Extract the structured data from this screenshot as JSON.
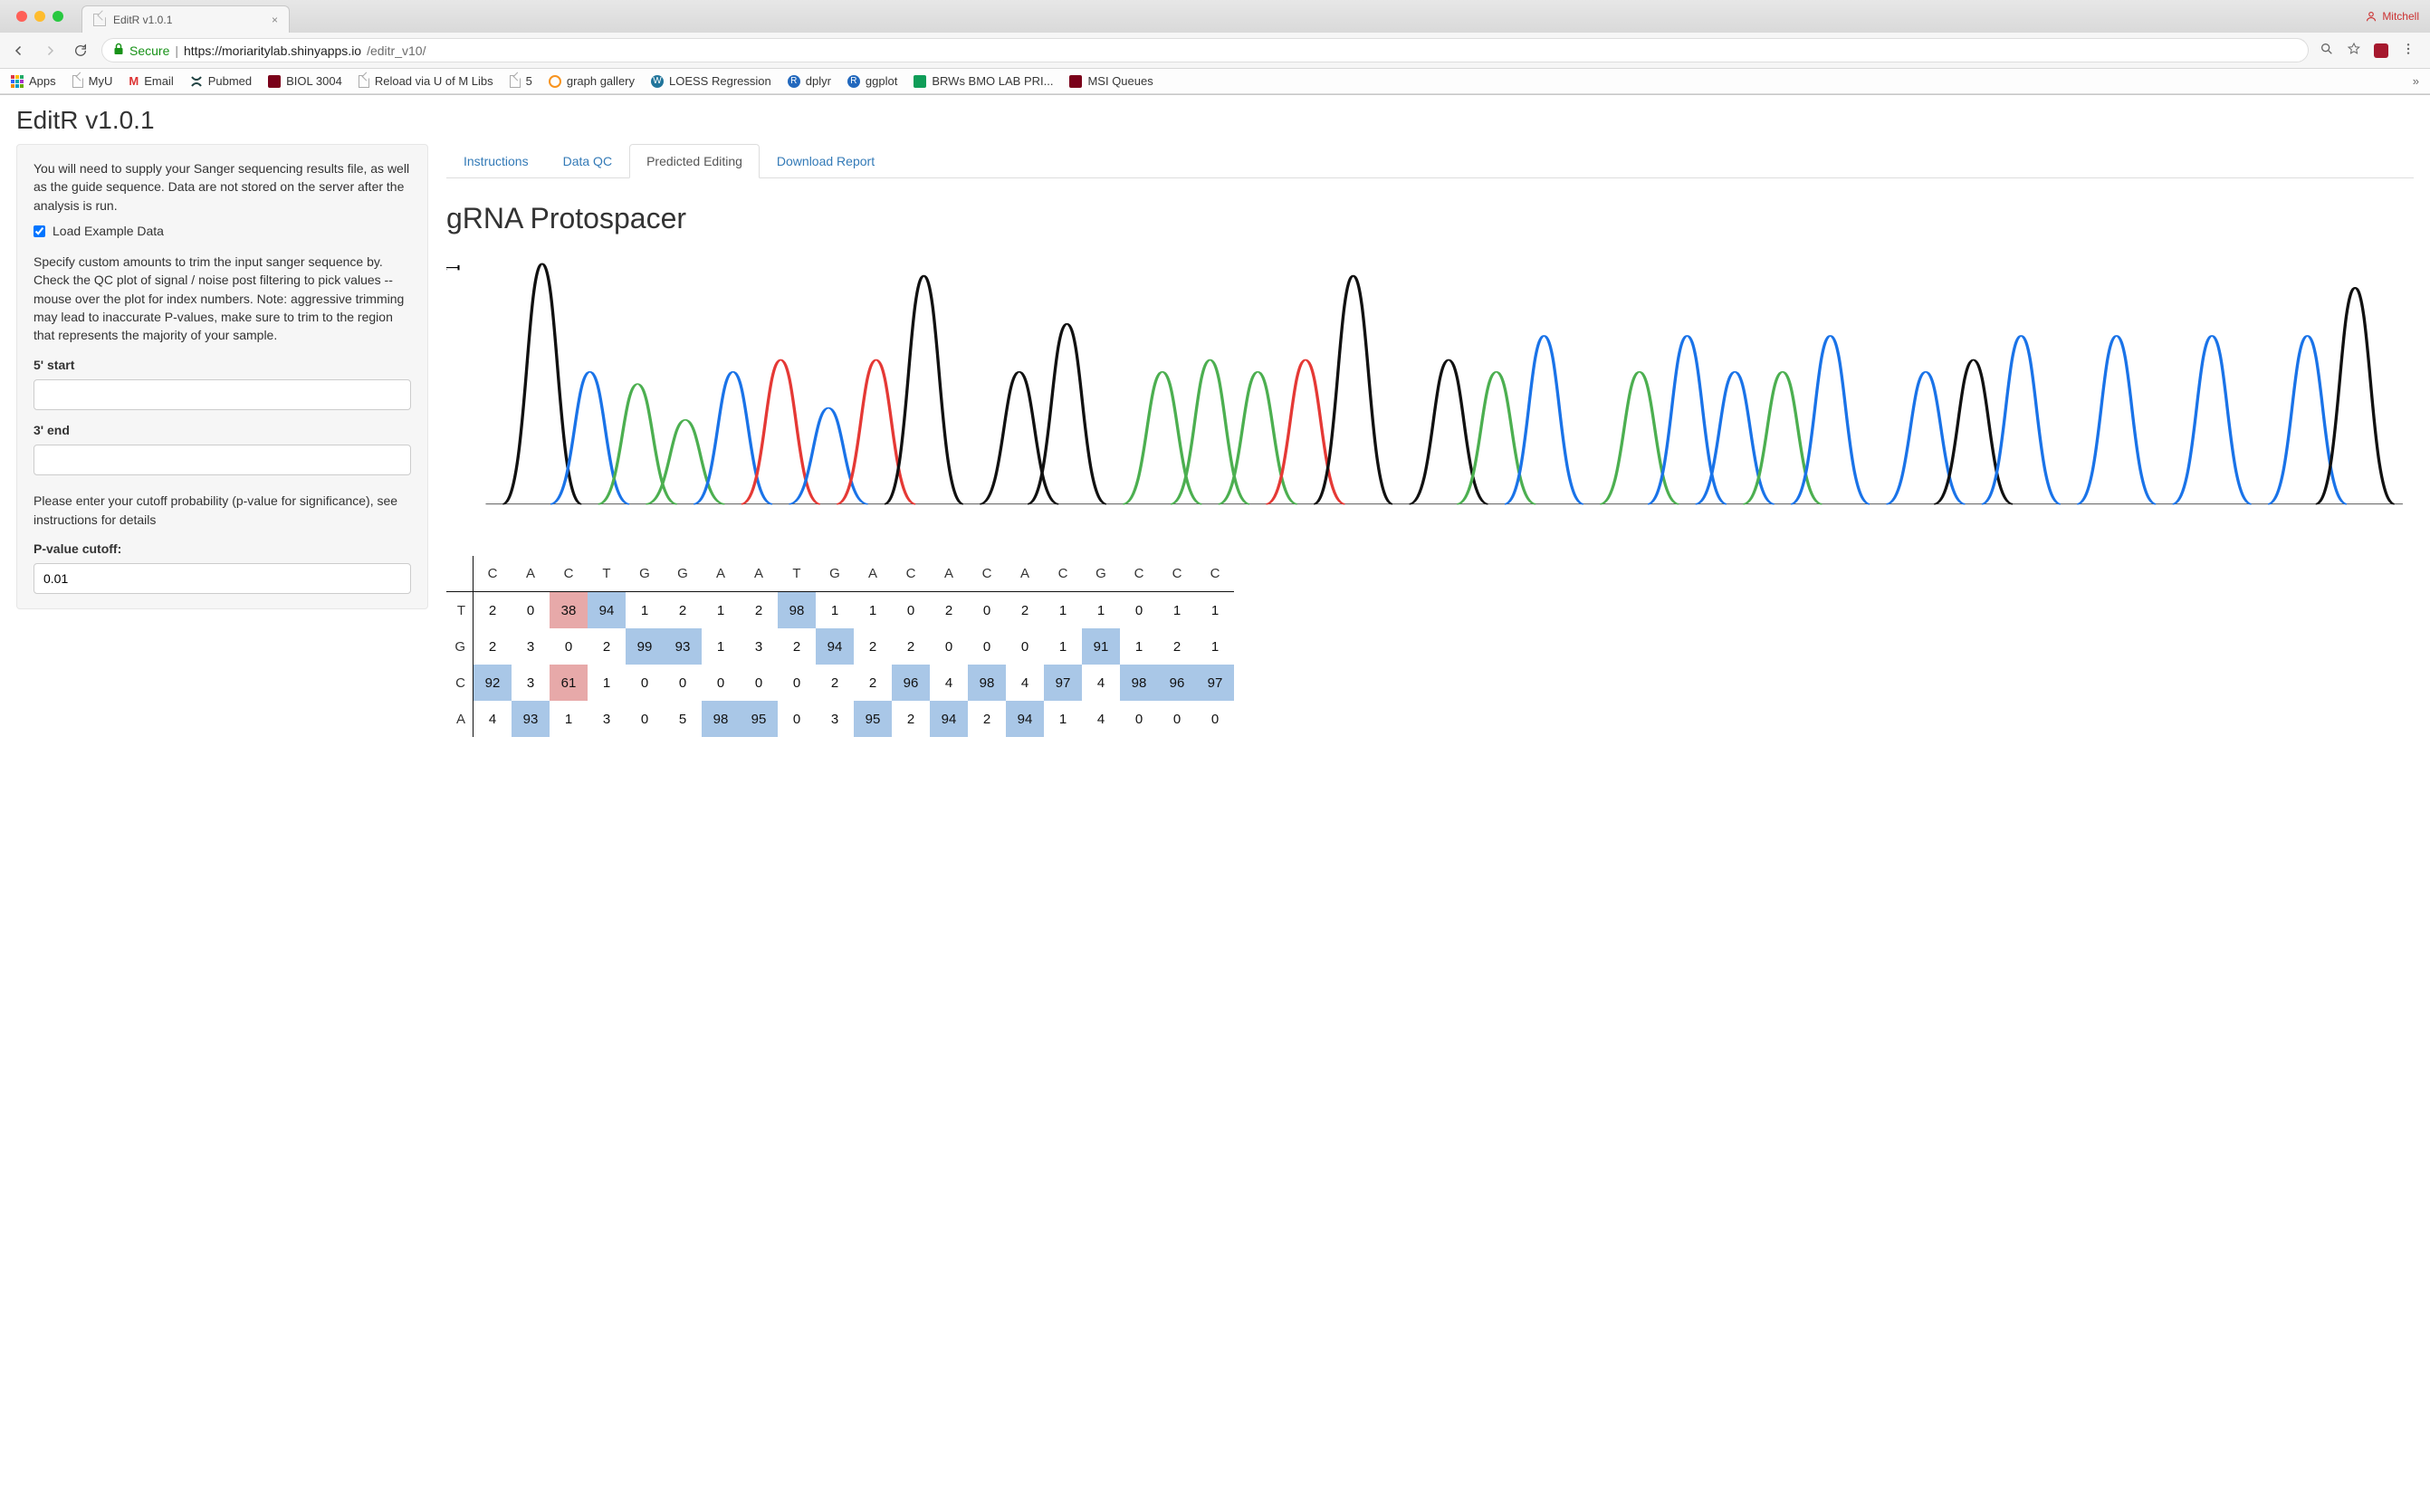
{
  "browser": {
    "tab_title": "EditR v1.0.1",
    "profile_name": "Mitchell",
    "url_secure_label": "Secure",
    "url_host": "https://moriaritylab.shinyapps.io",
    "url_path": "/editr_v10/"
  },
  "bookmarks": [
    {
      "label": "Apps",
      "icon": "apps"
    },
    {
      "label": "MyU",
      "icon": "file"
    },
    {
      "label": "Email",
      "icon": "gmail"
    },
    {
      "label": "Pubmed",
      "icon": "ncbi"
    },
    {
      "label": "BIOL 3004",
      "icon": "umn"
    },
    {
      "label": "Reload via U of M Libs",
      "icon": "file"
    },
    {
      "label": "5",
      "icon": "file"
    },
    {
      "label": "graph gallery",
      "icon": "orange-circle"
    },
    {
      "label": "LOESS Regression",
      "icon": "wp"
    },
    {
      "label": "dplyr",
      "icon": "r"
    },
    {
      "label": "ggplot",
      "icon": "r"
    },
    {
      "label": "BRWs BMO LAB PRI...",
      "icon": "sheet"
    },
    {
      "label": "MSI Queues",
      "icon": "umn"
    }
  ],
  "app": {
    "title": "EditR v1.0.1",
    "sidebar": {
      "intro": "You will need to supply your Sanger sequencing results file, as well as the guide sequence. Data are not stored on the server after the analysis is run.",
      "load_example_label": "Load Example Data",
      "load_example_checked": true,
      "trim_help": "Specify custom amounts to trim the input sanger sequence by. Check the QC plot of signal / noise post filtering to pick values -- mouse over the plot for index numbers. Note: aggressive trimming may lead to inaccurate P-values, make sure to trim to the region that represents the majority of your sample.",
      "label_5p": "5' start",
      "value_5p": "",
      "label_3p": "3' end",
      "value_3p": "",
      "pval_help": "Please enter your cutoff probability (p-value for significance), see instructions for details",
      "label_pval": "P-value cutoff:",
      "value_pval": "0.01"
    },
    "tabs": {
      "instructions": "Instructions",
      "data_qc": "Data QC",
      "predicted": "Predicted Editing",
      "download": "Download Report",
      "active": "predicted"
    },
    "section_title": "gRNA Protospacer"
  },
  "chart_data": {
    "type": "line",
    "title": "gRNA Protospacer",
    "xlabel": "",
    "ylabel": "1",
    "y_axis_ticks": [
      "1"
    ],
    "xlim": [
      0,
      20
    ],
    "ylim": [
      0,
      1
    ],
    "base_colors": {
      "A": "#4caf50",
      "C": "#1a73e8",
      "G": "#111111",
      "T": "#e53935"
    },
    "protospacer": [
      "C",
      "A",
      "C",
      "T",
      "G",
      "G",
      "A",
      "A",
      "T",
      "G",
      "A",
      "C",
      "A",
      "C",
      "A",
      "C",
      "G",
      "C",
      "C",
      "C"
    ],
    "peaks": [
      {
        "pos": 0.5,
        "base": "G",
        "height": 1.0
      },
      {
        "pos": 1.0,
        "base": "C",
        "height": 0.55
      },
      {
        "pos": 1.5,
        "base": "A",
        "height": 0.5
      },
      {
        "pos": 2.0,
        "base": "A",
        "height": 0.35
      },
      {
        "pos": 2.5,
        "base": "C",
        "height": 0.55
      },
      {
        "pos": 3.0,
        "base": "T",
        "height": 0.6
      },
      {
        "pos": 3.5,
        "base": "C",
        "height": 0.4
      },
      {
        "pos": 4.0,
        "base": "T",
        "height": 0.6
      },
      {
        "pos": 4.5,
        "base": "G",
        "height": 0.95
      },
      {
        "pos": 5.5,
        "base": "G",
        "height": 0.55
      },
      {
        "pos": 6.0,
        "base": "G",
        "height": 0.75
      },
      {
        "pos": 7.0,
        "base": "A",
        "height": 0.55
      },
      {
        "pos": 7.5,
        "base": "A",
        "height": 0.6
      },
      {
        "pos": 8.0,
        "base": "A",
        "height": 0.55
      },
      {
        "pos": 8.5,
        "base": "T",
        "height": 0.6
      },
      {
        "pos": 9.0,
        "base": "G",
        "height": 0.95
      },
      {
        "pos": 10.0,
        "base": "G",
        "height": 0.6
      },
      {
        "pos": 10.5,
        "base": "A",
        "height": 0.55
      },
      {
        "pos": 11.0,
        "base": "C",
        "height": 0.7
      },
      {
        "pos": 12.0,
        "base": "A",
        "height": 0.55
      },
      {
        "pos": 12.5,
        "base": "C",
        "height": 0.7
      },
      {
        "pos": 13.0,
        "base": "C",
        "height": 0.55
      },
      {
        "pos": 13.5,
        "base": "A",
        "height": 0.55
      },
      {
        "pos": 14.0,
        "base": "C",
        "height": 0.7
      },
      {
        "pos": 15.0,
        "base": "C",
        "height": 0.55
      },
      {
        "pos": 15.5,
        "base": "G",
        "height": 0.6
      },
      {
        "pos": 16.0,
        "base": "C",
        "height": 0.7
      },
      {
        "pos": 17.0,
        "base": "C",
        "height": 0.7
      },
      {
        "pos": 18.0,
        "base": "C",
        "height": 0.7
      },
      {
        "pos": 19.0,
        "base": "C",
        "height": 0.7
      },
      {
        "pos": 19.5,
        "base": "G",
        "height": 0.9
      }
    ]
  },
  "heatmap": {
    "columns": [
      "C",
      "A",
      "C",
      "T",
      "G",
      "G",
      "A",
      "A",
      "T",
      "G",
      "A",
      "C",
      "A",
      "C",
      "A",
      "C",
      "G",
      "C",
      "C",
      "C"
    ],
    "rows": [
      "T",
      "G",
      "C",
      "A"
    ],
    "values": {
      "T": [
        2,
        0,
        38,
        94,
        1,
        2,
        1,
        2,
        98,
        1,
        1,
        0,
        2,
        0,
        2,
        1,
        1,
        0,
        1,
        1
      ],
      "G": [
        2,
        3,
        0,
        2,
        99,
        93,
        1,
        3,
        2,
        94,
        2,
        2,
        0,
        0,
        0,
        1,
        91,
        1,
        2,
        1
      ],
      "C": [
        92,
        3,
        61,
        1,
        0,
        0,
        0,
        0,
        0,
        2,
        2,
        96,
        4,
        98,
        4,
        97,
        4,
        98,
        96,
        97
      ],
      "A": [
        4,
        93,
        1,
        3,
        0,
        5,
        98,
        95,
        0,
        3,
        95,
        2,
        94,
        2,
        94,
        1,
        4,
        0,
        0,
        0
      ]
    },
    "highlight": {
      "blue": [
        [
          "T",
          3
        ],
        [
          "T",
          4
        ],
        [
          "T",
          9
        ],
        [
          "G",
          5
        ],
        [
          "G",
          6
        ],
        [
          "G",
          10
        ],
        [
          "G",
          17
        ],
        [
          "C",
          1
        ],
        [
          "C",
          12
        ],
        [
          "C",
          14
        ],
        [
          "C",
          16
        ],
        [
          "C",
          18
        ],
        [
          "C",
          19
        ],
        [
          "C",
          20
        ],
        [
          "A",
          2
        ],
        [
          "A",
          7
        ],
        [
          "A",
          8
        ],
        [
          "A",
          11
        ],
        [
          "A",
          13
        ],
        [
          "A",
          15
        ]
      ],
      "red": [
        [
          "T",
          3
        ],
        [
          "C",
          3
        ]
      ]
    }
  }
}
